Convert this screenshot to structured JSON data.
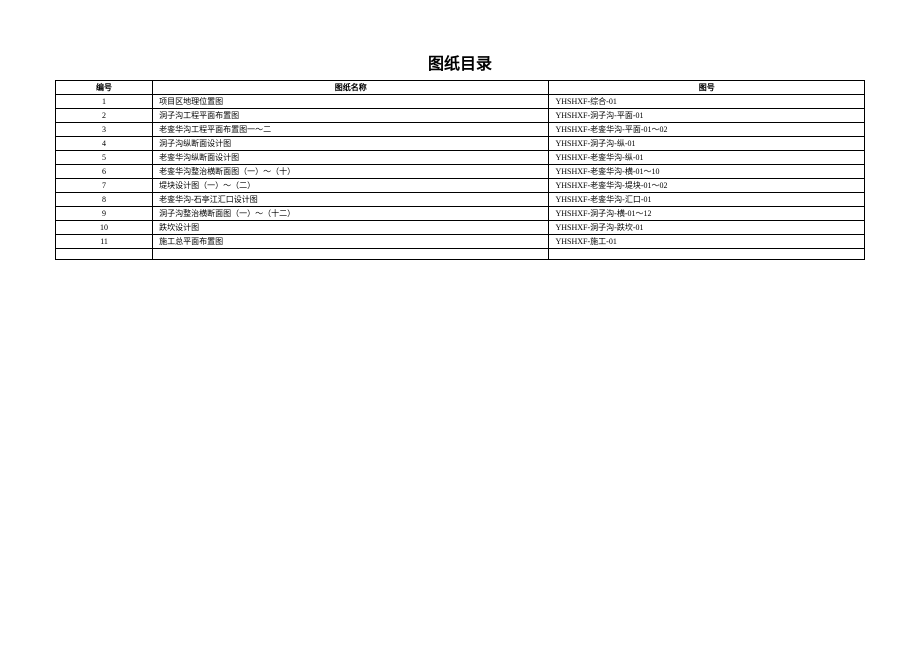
{
  "title": "图纸目录",
  "headers": {
    "num": "编号",
    "name": "图纸名称",
    "code": "图号"
  },
  "rows": [
    {
      "num": "1",
      "name": "项目区地理位置图",
      "code": "YHSHXF-综合-01"
    },
    {
      "num": "2",
      "name": "洞子沟工程平面布置图",
      "code": "YHSHXF-洞子沟-平面-01"
    },
    {
      "num": "3",
      "name": "老銮华沟工程平面布置图一～二",
      "code": "YHSHXF-老銮华沟-平面-01～02"
    },
    {
      "num": "4",
      "name": "洞子沟纵断面设计图",
      "code": "YHSHXF-洞子沟-纵-01"
    },
    {
      "num": "5",
      "name": "老銮华沟纵断面设计图",
      "code": "YHSHXF-老銮华沟-纵-01"
    },
    {
      "num": "6",
      "name": "老銮华沟整治横断面图（一）～（十）",
      "code": "YHSHXF-老銮华沟-横-01～10"
    },
    {
      "num": "7",
      "name": "堤块设计图（一）～（二）",
      "code": "YHSHXF-老銮华沟-堤块-01～02"
    },
    {
      "num": "8",
      "name": "老銮华沟-石亭江汇口设计图",
      "code": "YHSHXF-老銮华沟-汇口-01"
    },
    {
      "num": "9",
      "name": "洞子沟整治横断面图（一）～（十二）",
      "code": "YHSHXF-洞子沟-横-01～12"
    },
    {
      "num": "10",
      "name": "跌坎设计图",
      "code": "YHSHXF-洞子沟-跌坎-01"
    },
    {
      "num": "11",
      "name": "施工总平面布置图",
      "code": "YHSHXF-施工-01"
    }
  ],
  "blank_rows": 1
}
